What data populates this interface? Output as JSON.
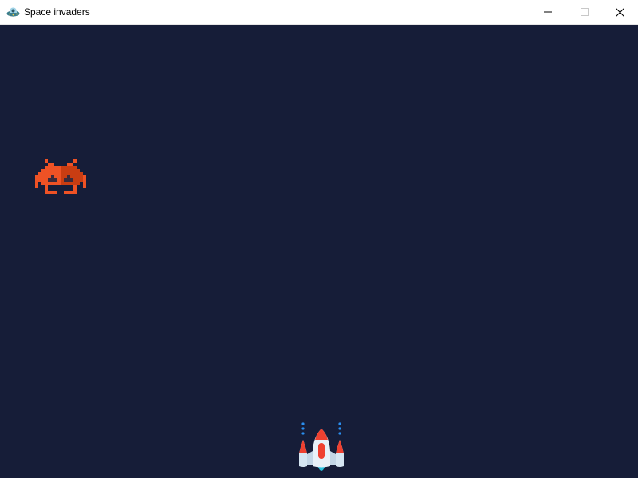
{
  "window": {
    "title": "Space invaders",
    "icon": "ufo-icon"
  },
  "controls": {
    "minimize_icon": "minimize-icon",
    "maximize_icon": "maximize-icon",
    "close_icon": "close-icon"
  },
  "game": {
    "background_color": "#161d38",
    "enemies": [
      {
        "icon": "space-invader-alien-icon",
        "color": "#e84a1e"
      }
    ],
    "player": {
      "icon": "player-spaceship-icon",
      "colors": [
        "#d6e6f2",
        "#ef4130",
        "#2ac3df"
      ]
    }
  }
}
